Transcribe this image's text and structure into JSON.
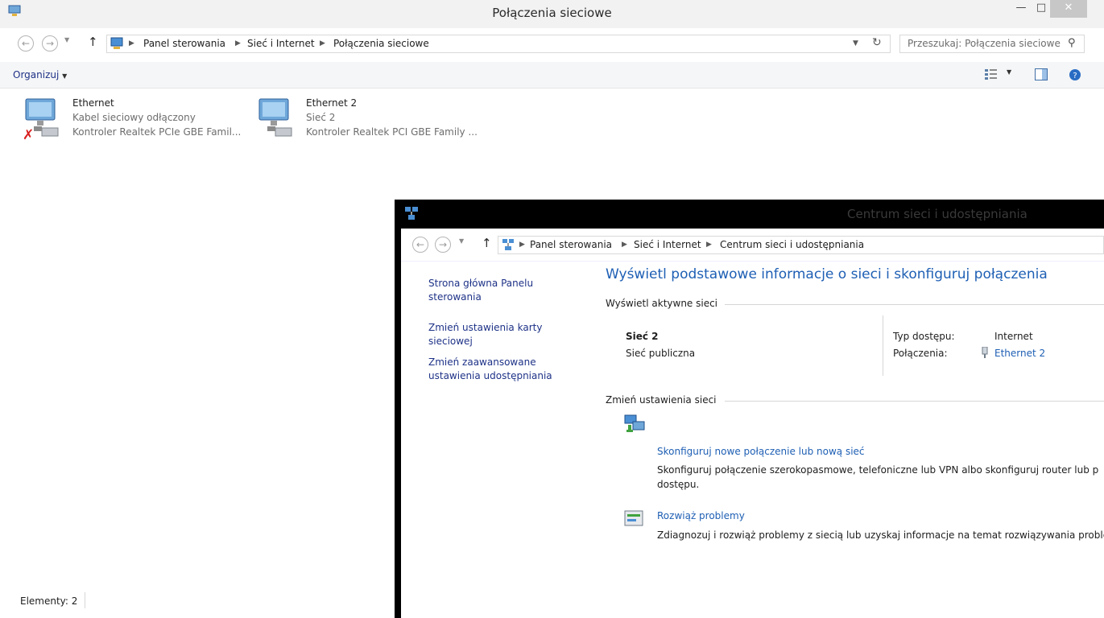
{
  "main_window": {
    "title": "Połączenia sieciowe",
    "breadcrumb": [
      "Panel sterowania",
      "Sieć i Internet",
      "Połączenia sieciowe"
    ],
    "search_placeholder": "Przeszukaj: Połączenia sieciowe",
    "organize_label": "Organizuj",
    "connections": [
      {
        "name": "Ethernet",
        "status": "Kabel sieciowy odłączony",
        "adapter": "Kontroler Realtek PCIe GBE Famil..."
      },
      {
        "name": "Ethernet 2",
        "status": "Sieć 2",
        "adapter": "Kontroler Realtek PCI GBE Family ..."
      }
    ],
    "status_bar": "Elementy: 2"
  },
  "second_window": {
    "title": "Centrum sieci i udostępniania",
    "breadcrumb": [
      "Panel sterowania",
      "Sieć i Internet",
      "Centrum sieci i udostępniania"
    ],
    "left_links": [
      "Strona główna Panelu sterowania",
      "Zmień ustawienia karty sieciowej",
      "Zmień zaawansowane ustawienia udostępniania"
    ],
    "heading": "Wyświetl podstawowe informacje o sieci i skonfiguruj połączenia",
    "active_networks_label": "Wyświetl aktywne sieci",
    "network_name": "Sieć 2",
    "network_type": "Sieć publiczna",
    "access_type_label": "Typ dostępu:",
    "access_type_value": "Internet",
    "connections_label": "Połączenia:",
    "connections_value": "Ethernet 2",
    "change_settings_label": "Zmień ustawienia sieci",
    "tasks": [
      {
        "title": "Skonfiguruj nowe połączenie lub nową sieć",
        "desc_line1": "Skonfiguruj połączenie szerokopasmowe, telefoniczne lub VPN albo skonfiguruj router lub p",
        "desc_line2": "dostępu."
      },
      {
        "title": "Rozwiąż problemy",
        "desc_line1": "Zdiagnozuj i rozwiąż problemy z siecią lub uzyskaj informacje na temat rozwiązywania proble",
        "desc_line2": ""
      }
    ]
  },
  "colors": {
    "link": "#1e5fb4",
    "dark_link": "#1e3287",
    "titlebar": "#f2f2f2",
    "close_button": "#c7c7c7",
    "error_x": "#d81e1e"
  }
}
